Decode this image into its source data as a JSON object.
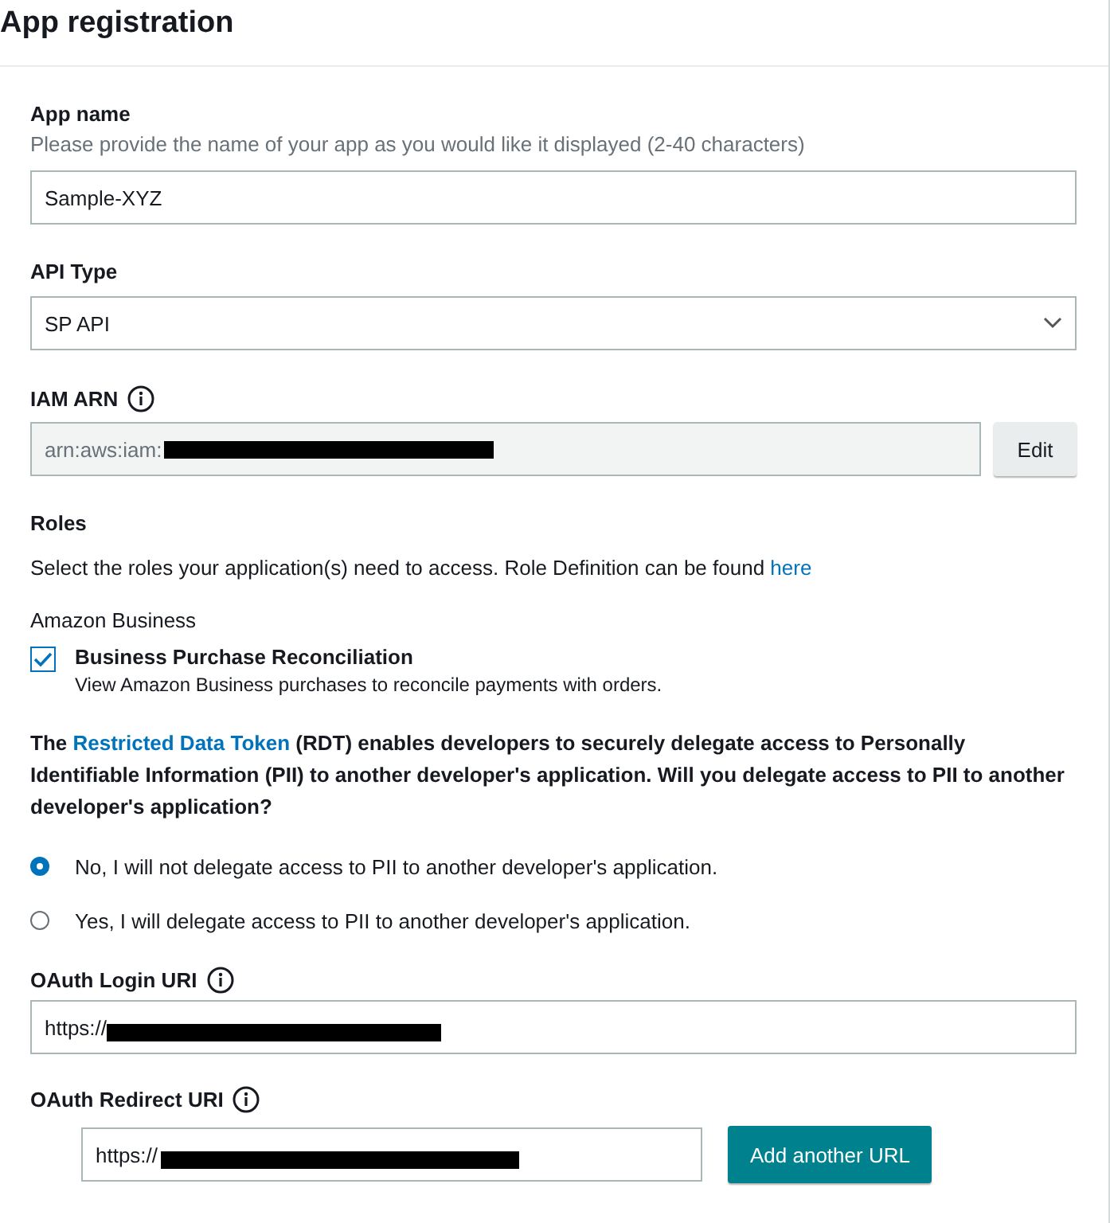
{
  "title": "App registration",
  "app_name": {
    "label": "App name",
    "hint": "Please provide the name of your app as you would like it displayed (2-40 characters)",
    "value": "Sample-XYZ"
  },
  "api_type": {
    "label": "API Type",
    "value": "SP API"
  },
  "iam_arn": {
    "label": "IAM ARN",
    "value": "arn:aws:iam:",
    "button": "Edit"
  },
  "roles": {
    "heading": "Roles",
    "description": "Select the roles your application(s) need to access. Role Definition can be found ",
    "link": "here",
    "group": "Amazon Business",
    "items": [
      {
        "label": "Business Purchase Reconciliation",
        "description": "View Amazon Business purchases to reconcile payments with orders.",
        "checked": true
      }
    ]
  },
  "rdt": {
    "before": "The ",
    "link": "Restricted Data Token",
    "after": " (RDT) enables developers to securely delegate access to Personally Identifiable Information (PII) to another developer's application. Will you delegate access to PII to another developer's application?",
    "options": [
      {
        "label": "No, I will not delegate access to PII to another developer's application.",
        "selected": true
      },
      {
        "label": "Yes, I will delegate access to PII to another developer's application.",
        "selected": false
      }
    ]
  },
  "oauth_login": {
    "label": "OAuth Login URI",
    "value": "https://"
  },
  "oauth_redirect": {
    "label": "OAuth Redirect URI",
    "value": "https://",
    "button": "Add another URL"
  }
}
